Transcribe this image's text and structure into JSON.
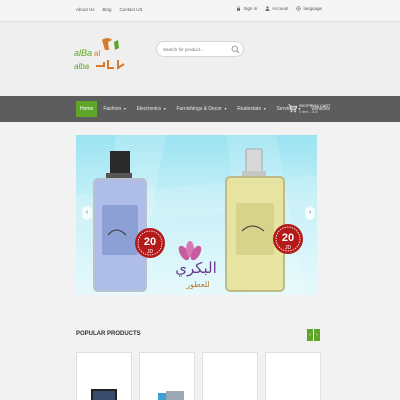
{
  "top_links": [
    "About Us",
    "Blog",
    "Contact US"
  ],
  "top_right": {
    "signin": "Sign in",
    "account": "Account",
    "language": "language"
  },
  "logo_text": {
    "latin": "alBa alAkk",
    "arabic": "البلد البلاد"
  },
  "search": {
    "placeholder": "Search for product..."
  },
  "nav": [
    {
      "label": "Home",
      "active": true,
      "dropdown": false
    },
    {
      "label": "Fashion",
      "active": false,
      "dropdown": true
    },
    {
      "label": "Electronics",
      "active": false,
      "dropdown": true
    },
    {
      "label": "Furnishings & Decor",
      "active": false,
      "dropdown": true
    },
    {
      "label": "Realestate",
      "active": false,
      "dropdown": true
    },
    {
      "label": "Services",
      "active": false,
      "dropdown": true
    },
    {
      "label": "Vehicles",
      "active": false,
      "dropdown": false
    }
  ],
  "cart": {
    "title": "SHOPPING CART",
    "items": "0 item - JD0"
  },
  "banner": {
    "price_left": "20",
    "currency_left": "JD",
    "price_right": "20",
    "currency_right": "JD",
    "brand_arabic": "البكري",
    "brand_sub": "للعطور"
  },
  "popular": {
    "title": "POPULAR PRODUCTS",
    "prev": "‹",
    "next": "›"
  },
  "colors": {
    "accent": "#5fa52a",
    "nav_bg": "#5d5d5d",
    "price_badge": "#b51a1a"
  }
}
